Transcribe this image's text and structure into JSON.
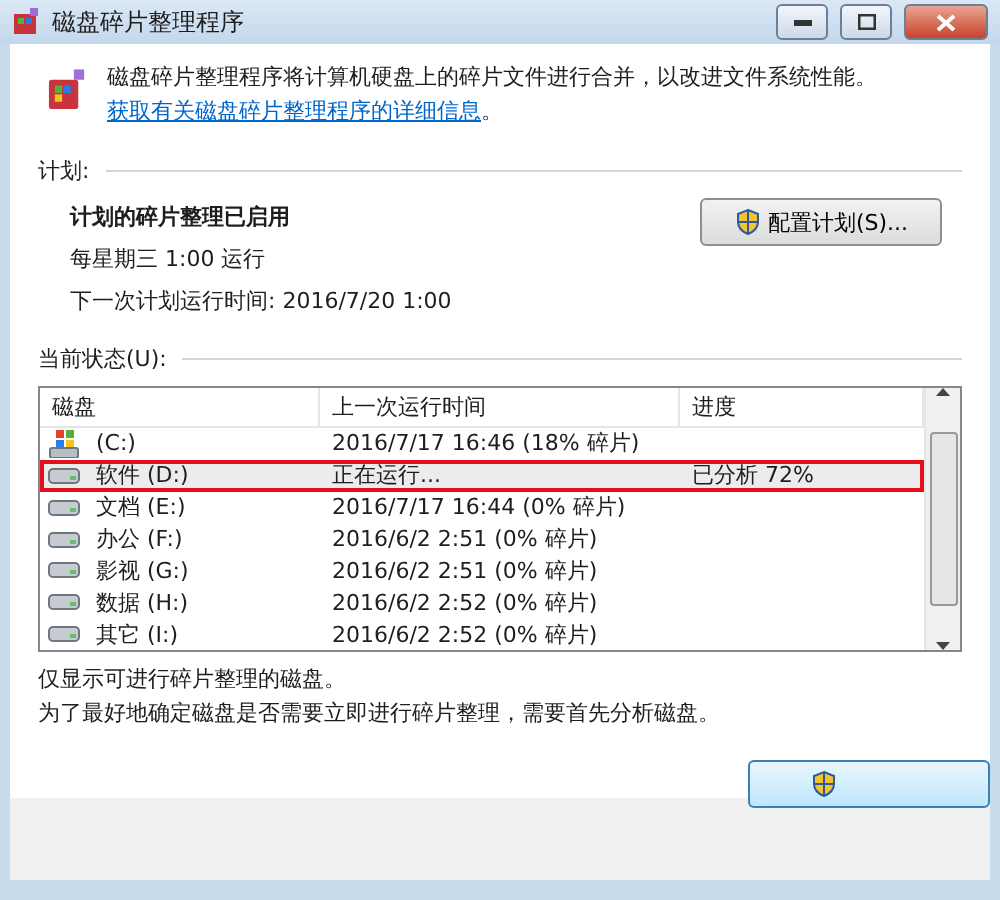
{
  "window": {
    "title": "磁盘碎片整理程序"
  },
  "intro": {
    "text": "磁盘碎片整理程序将计算机硬盘上的碎片文件进行合并，以改进文件系统性能。",
    "link": "获取有关磁盘碎片整理程序的详细信息",
    "tail": "。"
  },
  "schedule": {
    "heading": "计划:",
    "status": "计划的碎片整理已启用",
    "frequency": "每星期三  1:00 运行",
    "next_run": "下一次计划运行时间: 2016/7/20 1:00",
    "button": "配置计划(S)..."
  },
  "current_status": {
    "heading": "当前状态(U):",
    "columns": [
      "磁盘",
      "上一次运行时间",
      "进度"
    ],
    "rows": [
      {
        "disk": "(C:)",
        "kind": "system",
        "last_run": "2016/7/17 16:46 (18% 碎片)",
        "progress": "",
        "selected": false
      },
      {
        "disk": "软件 (D:)",
        "kind": "data",
        "last_run": "正在运行...",
        "progress": "已分析 72%",
        "selected": true
      },
      {
        "disk": "文档 (E:)",
        "kind": "data",
        "last_run": "2016/7/17 16:44 (0% 碎片)",
        "progress": "",
        "selected": false
      },
      {
        "disk": "办公 (F:)",
        "kind": "data",
        "last_run": "2016/6/2 2:51 (0% 碎片)",
        "progress": "",
        "selected": false
      },
      {
        "disk": "影视 (G:)",
        "kind": "data",
        "last_run": "2016/6/2 2:51 (0% 碎片)",
        "progress": "",
        "selected": false
      },
      {
        "disk": "数据 (H:)",
        "kind": "data",
        "last_run": "2016/6/2 2:52 (0% 碎片)",
        "progress": "",
        "selected": false
      },
      {
        "disk": "其它 (I:)",
        "kind": "data",
        "last_run": "2016/6/2 2:52 (0% 碎片)",
        "progress": "",
        "selected": false
      }
    ]
  },
  "notes": [
    "仅显示可进行碎片整理的磁盘。",
    "为了最好地确定磁盘是否需要立即进行碎片整理，需要首先分析磁盘。"
  ]
}
